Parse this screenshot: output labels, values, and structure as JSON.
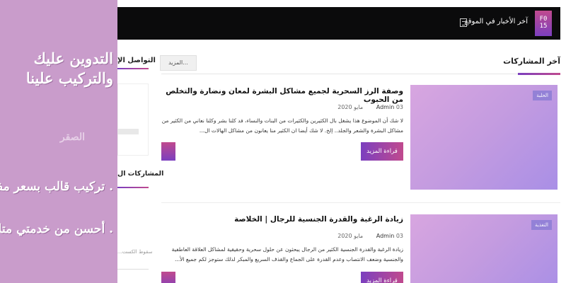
{
  "header": {
    "logo_text": "F0\n15",
    "ticker_label": "آخر الأخبار في الموقع"
  },
  "latest_section": {
    "title": "آخر المشاركات",
    "more_label": "المزيد..."
  },
  "posts": [
    {
      "category": "الحلبة",
      "title": "وصفة الرز السحرية لجميع مشاكل البشرة لمعان ونضارة والتخلص من الحبوب",
      "author": "Admin",
      "date": "03 مايو 2020",
      "excerpt": "لا شك أن الموضوع هذا يشغل بال الكثيرين والكثيرات من البنات والنساء، فد كلنا بشر وكلنا نعاني من الكثير من مشاكل البشرة والشعر والجلد.. إلخ. لا شك أيضا ان الكثير منا يعانون من مشاكل الهالات ال...",
      "read_more": "قراءة المزيد"
    },
    {
      "category": "التغذية",
      "title": "زيادة الرغبة والقدرة الجنسية للرجال | الخلاصة",
      "author": "Admin",
      "date": "03 مايو 2020",
      "excerpt": "زيادة الرغبة والقدرة الجنسية الكثير من الرجال يبحثون عن حلول سحرية وحقيقية لمشاكل العلاقة العاطفية والجنسية وضعف الانتصاب وعدم القدرة على الجماع والقذف السريع والمبكر لذلك ستوجز لكم جميع الأ...",
      "read_more": "قراءة المزيد"
    }
  ],
  "sidebar": {
    "widget1_title": "التواصل الإ",
    "widget2_title": "المشاركات ال",
    "cut_text": "سقوط الكست..."
  },
  "overlay": {
    "line1": "التدوين عليك",
    "line2": "والتركيب علينا",
    "line3": "الصقر",
    "line4": ". تركيب قالب بسعر مفيش",
    "line5": ". أحسن من خدمتي متلاقيش"
  }
}
